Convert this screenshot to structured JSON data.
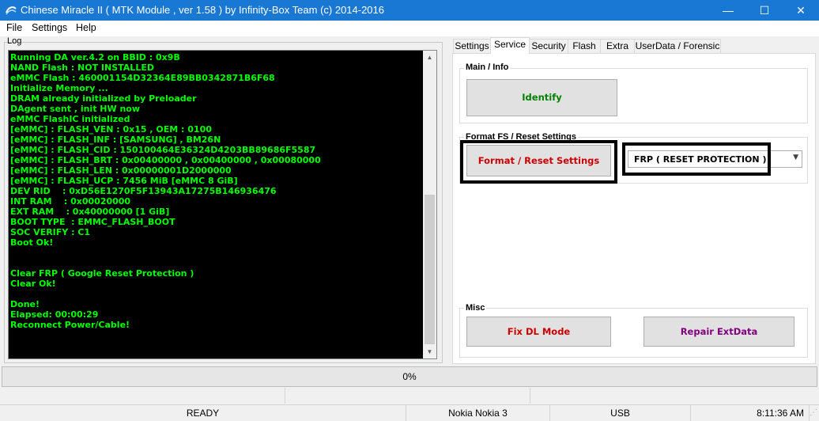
{
  "window": {
    "title": "Chinese Miracle II ( MTK Module , ver 1.58 ) by Infinity-Box Team (c) 2014-2016",
    "minimize": "—",
    "maximize": "☐",
    "close": "✕"
  },
  "menu": {
    "file": "File",
    "settings": "Settings",
    "help": "Help"
  },
  "log": {
    "label": "Log",
    "lines": [
      "Running DA ver.4.2 on BBID : 0x9B",
      "NAND Flash : NOT INSTALLED",
      "eMMC Flash : 460001154D32364E89BB0342871B6F68",
      "Initialize Memory ...",
      "DRAM already initialized by Preloader",
      "DAgent sent , init HW now",
      "eMMC FlashIC initialized",
      "[eMMC] : FLASH_VEN : 0x15 , OEM : 0100",
      "[eMMC] : FLASH_INF : [SAMSUNG] , BM26N",
      "[eMMC] : FLASH_CID : 150100464E36324D4203BB89686F5587",
      "[eMMC] : FLASH_BRT : 0x00400000 , 0x00400000 , 0x00080000",
      "[eMMC] : FLASH_LEN : 0x00000001D2000000",
      "[eMMC] : FLASH_UCP : 7456 MiB [eMMC 8 GiB]",
      "DEV RID    : 0xD56E1270F5F13943A17275B146936476",
      "INT RAM    : 0x00020000",
      "EXT RAM    : 0x40000000 [1 GiB]",
      "BOOT TYPE  : EMMC_FLASH_BOOT",
      "SOC VERIFY : C1",
      "Boot Ok!",
      "",
      "",
      "Clear FRP ( Google Reset Protection )",
      "Clear Ok!",
      "",
      "Done!",
      "Elapsed: 00:00:29",
      "Reconnect Power/Cable!"
    ]
  },
  "tabs": [
    "Settings",
    "Service",
    "Security",
    "Flash",
    "Extra",
    "UserData / Forensic"
  ],
  "active_tab": "Service",
  "service": {
    "main_info_title": "Main / Info",
    "identify_label": "Identify",
    "format_title": "Format FS / Reset Settings",
    "format_button_label": "Format / Reset Settings",
    "format_select_value": "FRP ( RESET PROTECTION )",
    "misc_title": "Misc",
    "fix_dl_label": "Fix DL Mode",
    "repair_label": "Repair ExtData"
  },
  "progress": {
    "text": "0%",
    "value": 0
  },
  "status": {
    "state": "READY",
    "device": "Nokia Nokia 3",
    "connection": "USB",
    "time": "8:11:36 AM"
  },
  "colors": {
    "titlebar": "#1978d4",
    "log_text": "#00ff00",
    "identify_text": "#008000",
    "format_text": "#cc0000",
    "fix_dl_text": "#cc0000",
    "repair_text": "#800080"
  }
}
